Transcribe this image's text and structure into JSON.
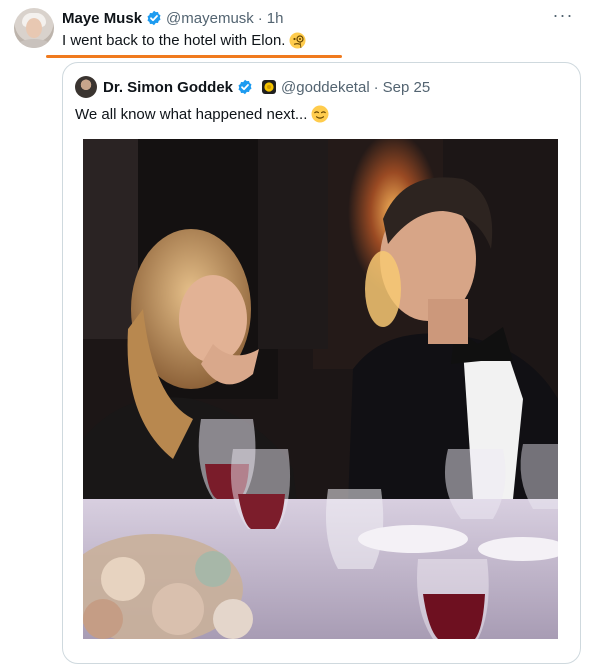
{
  "tweet": {
    "author_name": "Maye Musk",
    "handle": "@mayemusk",
    "separator": "·",
    "time": "1h",
    "text": "I went back to the hotel with Elon.",
    "more_icon": "more-horizontal-icon",
    "more_label": "···"
  },
  "quoted_tweet": {
    "author_name": "Dr. Simon Goddek",
    "handle": "@goddeketal",
    "separator": "·",
    "date": "Sep 25",
    "text": "We all know what happened next...",
    "media_icon": "photo"
  },
  "colors": {
    "verified_blue": "#1d9bf0",
    "underline_orange": "#f07a1e",
    "secondary_text": "#536471",
    "border": "#cfd9de"
  }
}
